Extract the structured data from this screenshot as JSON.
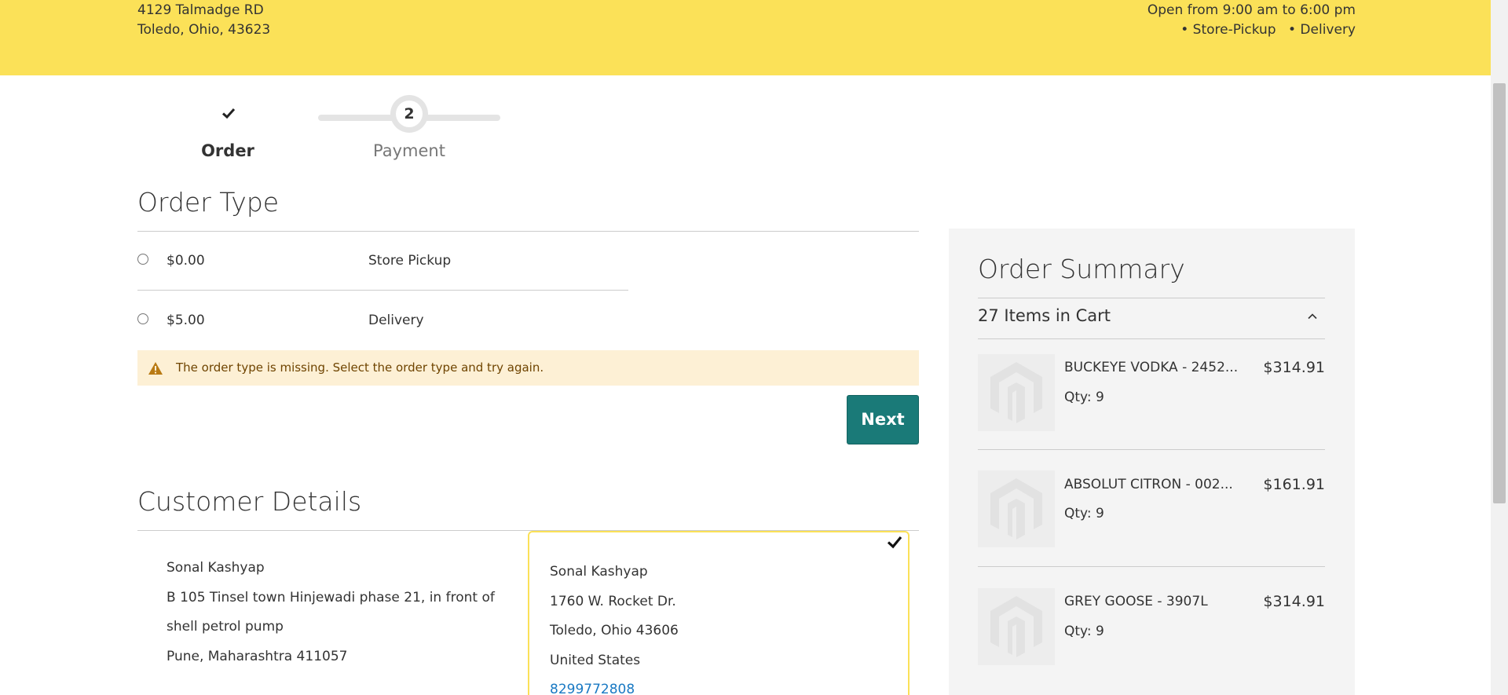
{
  "store": {
    "address_line1": "4129 Talmadge RD",
    "address_line2": "Toledo, Ohio, 43623",
    "hours": "Open from 9:00 am to 6:00 pm",
    "services": [
      "• Store-Pickup",
      "• Delivery"
    ]
  },
  "progress": {
    "steps": [
      {
        "label": "Order",
        "state": "complete",
        "icon": "check-icon"
      },
      {
        "label": "Payment",
        "number": "2",
        "state": "active"
      }
    ]
  },
  "order_type": {
    "title": "Order Type",
    "options": [
      {
        "price": "$0.00",
        "name": "Store Pickup",
        "selected": false
      },
      {
        "price": "$5.00",
        "name": "Delivery",
        "selected": false
      }
    ],
    "error": "The order type is missing. Select the order type and try again.",
    "next_label": "Next"
  },
  "customer": {
    "title": "Customer Details",
    "billing": {
      "name": "Sonal Kashyap",
      "street": "B 105 Tinsel town Hinjewadi phase 21, in front of",
      "street2": "shell petrol pump",
      "city": "Pune, Maharashtra 411057"
    },
    "shipping": {
      "name": "Sonal Kashyap",
      "street": "1760 W. Rocket Dr.",
      "city": "Toledo, Ohio 43606",
      "country": "United States",
      "phone": "8299772808",
      "selected": true
    }
  },
  "summary": {
    "title": "Order Summary",
    "count_label": "27 Items in Cart",
    "items": [
      {
        "name": "BUCKEYE VODKA - 2452...",
        "qty": "Qty: 9",
        "price": "$314.91"
      },
      {
        "name": "ABSOLUT CITRON - 002...",
        "qty": "Qty: 9",
        "price": "$161.91"
      },
      {
        "name": "GREY GOOSE - 3907L",
        "qty": "Qty: 9",
        "price": "$314.91"
      }
    ]
  },
  "colors": {
    "brand_yellow": "#fbe158",
    "button_teal": "#1a7a78",
    "error_bg": "#fdf0d5",
    "link_blue": "#1979c3"
  }
}
